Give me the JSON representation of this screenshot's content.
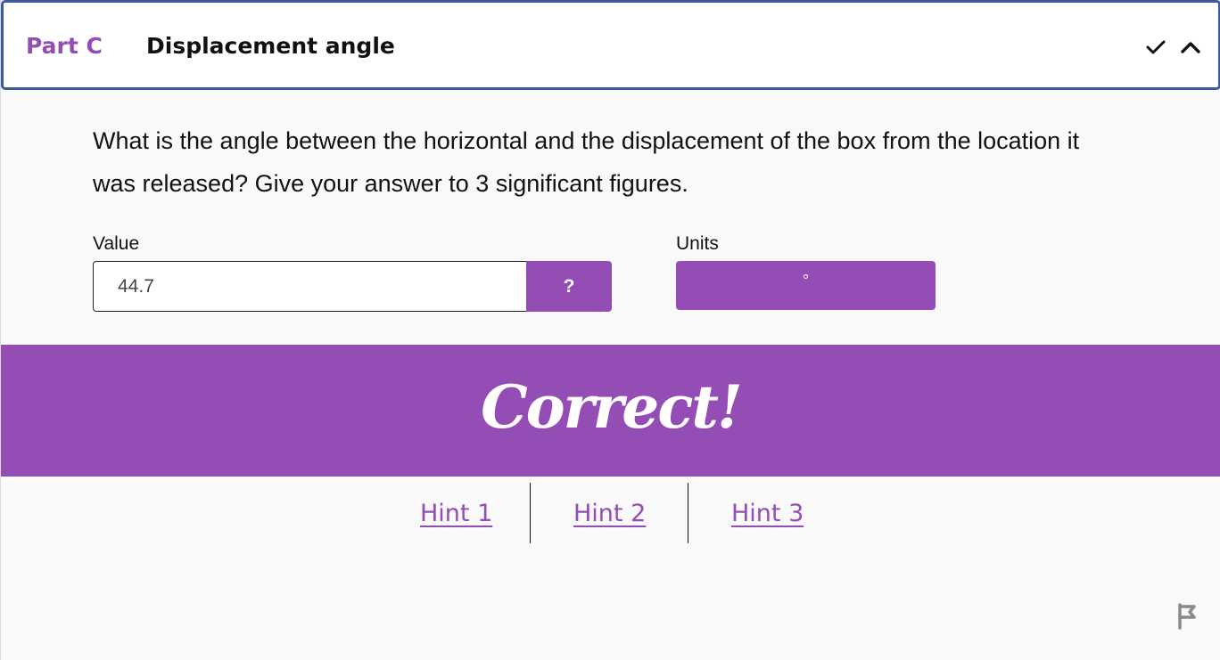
{
  "header": {
    "part_label": "Part C",
    "title": "Displacement angle",
    "check_icon": "check-icon",
    "collapse_icon": "chevron-up-icon"
  },
  "question": {
    "text": "What is the angle between the horizontal and the displacement of the box from the location it was released? Give your answer to 3 significant figures."
  },
  "answer": {
    "value_label": "Value",
    "value": "44.7",
    "help_button_label": "?",
    "units_label": "Units",
    "units_value": "°"
  },
  "feedback": {
    "message": "Correct!"
  },
  "hints": [
    {
      "label": "Hint 1"
    },
    {
      "label": "Hint 2"
    },
    {
      "label": "Hint 3"
    }
  ],
  "footer": {
    "flag_icon": "flag-icon"
  },
  "colors": {
    "accent": "#944db5",
    "header_border": "#3d5a9e",
    "background": "#f9f9f9"
  }
}
